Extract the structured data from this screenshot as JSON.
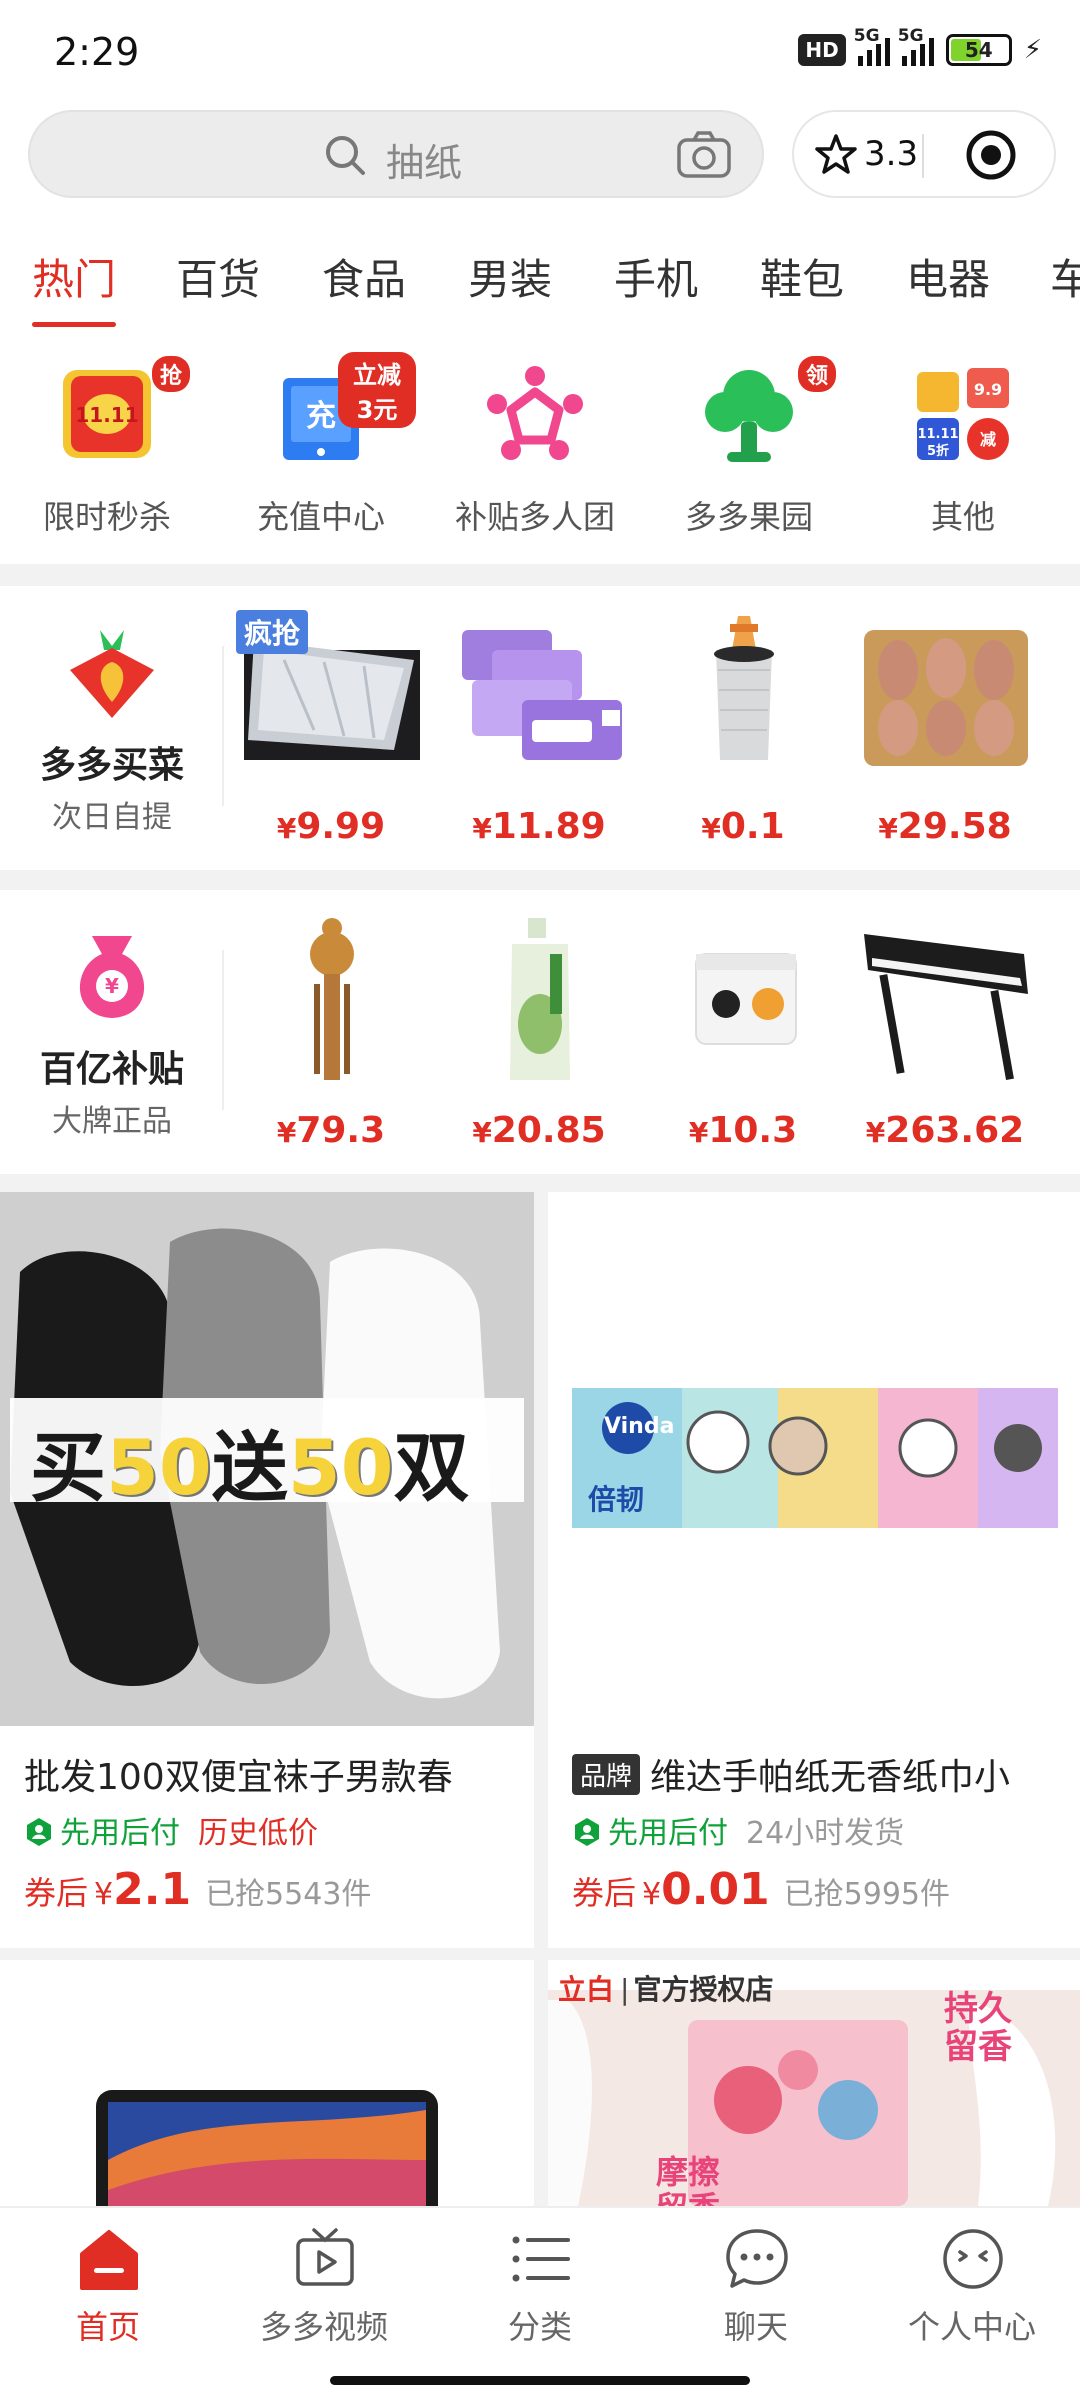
{
  "status": {
    "time": "2:29",
    "hd": "HD",
    "net1": "5G",
    "net2": "5G",
    "battery": "54",
    "battery_level": 0.54
  },
  "search": {
    "placeholder": "抽纸",
    "rating": "3.3"
  },
  "tabs": [
    "热门",
    "百货",
    "食品",
    "男装",
    "手机",
    "鞋包",
    "电器",
    "车"
  ],
  "quick_entries": [
    {
      "label": "限时秒杀",
      "badge": "抢",
      "icon": "flash-sale-icon"
    },
    {
      "label": "充值中心",
      "badge": "立减3元",
      "icon": "recharge-icon"
    },
    {
      "label": "补贴多人团",
      "badge": "",
      "icon": "group-buy-icon"
    },
    {
      "label": "多多果园",
      "badge": "领",
      "icon": "orchard-tree-icon"
    },
    {
      "label": "其他",
      "badge": "",
      "icon": "others-icon"
    }
  ],
  "promo1": {
    "title": "多多买菜",
    "subtitle": "次日自提",
    "tag": "疯抢",
    "items": [
      {
        "price": "9.99",
        "name": "windshield-sunshade-image"
      },
      {
        "price": "11.89",
        "name": "tissue-pack-image"
      },
      {
        "price": "0.1",
        "name": "garbage-bag-image"
      },
      {
        "price": "29.58",
        "name": "quail-meat-image"
      }
    ]
  },
  "promo2": {
    "title": "百亿补贴",
    "subtitle": "大牌正品",
    "items": [
      {
        "price": "79.3",
        "name": "hulusi-flute-image"
      },
      {
        "price": "20.85",
        "name": "shampoo-bottle-image"
      },
      {
        "price": "10.3",
        "name": "cream-jar-image"
      },
      {
        "price": "263.62",
        "name": "digital-piano-image"
      }
    ]
  },
  "products": [
    {
      "image_text_1": "买",
      "image_text_2": "50",
      "image_text_3": "送",
      "image_text_4": "50",
      "image_text_5": "双",
      "title": "批发100双便宜袜子男款春",
      "brand": "",
      "tag1": "先用后付",
      "tag2": "历史低价",
      "price_label": "券后",
      "price": "2.1",
      "sold": "已抢5543件"
    },
    {
      "image_text_1": "Vinda",
      "image_text_2": "倍韧",
      "title": "维达手帕纸无香纸巾小",
      "brand": "品牌",
      "tag1": "先用后付",
      "tag2": "24小时发货",
      "price_label": "券后",
      "price": "0.01",
      "sold": "已抢5995件"
    },
    {
      "title": ""
    },
    {
      "image_text_1": "立白",
      "image_text_2": "官方授权店",
      "image_text_3": "持久",
      "image_text_4": "留香",
      "image_text_5": "摩擦",
      "image_text_6": "留香",
      "title": ""
    }
  ],
  "bottom_nav": [
    {
      "label": "首页"
    },
    {
      "label": "多多视频"
    },
    {
      "label": "分类"
    },
    {
      "label": "聊天"
    },
    {
      "label": "个人中心"
    }
  ],
  "colors": {
    "accent": "#e02e24",
    "green": "#10a23a"
  }
}
